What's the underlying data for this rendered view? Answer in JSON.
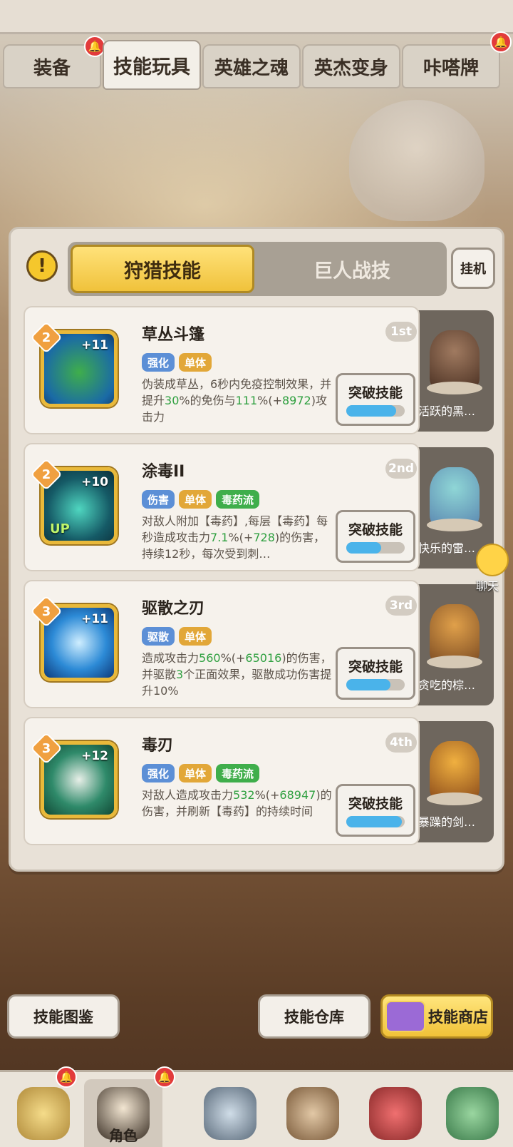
{
  "tabs": [
    {
      "label": "装备",
      "has_alert": true
    },
    {
      "label": "技能玩具",
      "active": true
    },
    {
      "label": "英雄之魂"
    },
    {
      "label": "英杰变身"
    },
    {
      "label": "咔嗒牌",
      "has_alert": true
    }
  ],
  "panel": {
    "warn_symbol": "!",
    "seg_active": "狩猎技能",
    "seg_inactive": "巨人战技",
    "idle_button": "挂机"
  },
  "skills": [
    {
      "name": "草丛斗篷",
      "rank": "1st",
      "level": "2",
      "plus": "+11",
      "tags": [
        "强化",
        "单体"
      ],
      "desc_parts": [
        "伪装成草丛，6秒内免疫控制效果，并提升",
        "30",
        "%的免伤与",
        "111",
        "%(+",
        "8972",
        ")攻击力"
      ],
      "break_label": "突破技能",
      "progress": 0.85,
      "companion": "活跃的黑…"
    },
    {
      "name": "涂毒II",
      "rank": "2nd",
      "level": "2",
      "plus": "+10",
      "up": "UP",
      "tags": [
        "伤害",
        "单体",
        "毒药流"
      ],
      "desc_parts": [
        "对敌人附加【毒药】,每层【毒药】每秒造成攻击力",
        "7.1",
        "%(+",
        "728",
        ")的伤害，持续12秒，每次受到刺…",
        "",
        ""
      ],
      "break_label": "突破技能",
      "progress": 0.6,
      "companion": "快乐的雷…"
    },
    {
      "name": "驱散之刃",
      "rank": "3rd",
      "level": "3",
      "plus": "+11",
      "tags": [
        "驱散",
        "单体"
      ],
      "desc_parts": [
        "造成攻击力",
        "560",
        "%(+",
        "65016",
        ")的伤害，并驱散",
        "3",
        "个正面效果，驱散成功伤害提升10%"
      ],
      "break_label": "突破技能",
      "progress": 0.75,
      "companion": "贪吃的棕…"
    },
    {
      "name": "毒刃",
      "rank": "4th",
      "level": "3",
      "plus": "+12",
      "tags": [
        "强化",
        "单体",
        "毒药流"
      ],
      "desc_parts": [
        "对敌人造成攻击力",
        "532",
        "%(+",
        "68947",
        ")的伤害，并刷新【毒药】的持续时间",
        "",
        ""
      ],
      "break_label": "突破技能",
      "progress": 0.95,
      "companion": "暴躁的剑…"
    }
  ],
  "chat_label": "聊天",
  "bottom_buttons": {
    "atlas": "技能图鉴",
    "storage": "技能仓库",
    "shop": "技能商店"
  },
  "nav": {
    "active_label": "角色"
  },
  "colors": {
    "gold": "#f0c23b",
    "blue_tag": "#5c8fd6",
    "gold_tag": "#e2a738",
    "green_tag": "#3fae4b",
    "progress": "#4ab3ea"
  }
}
